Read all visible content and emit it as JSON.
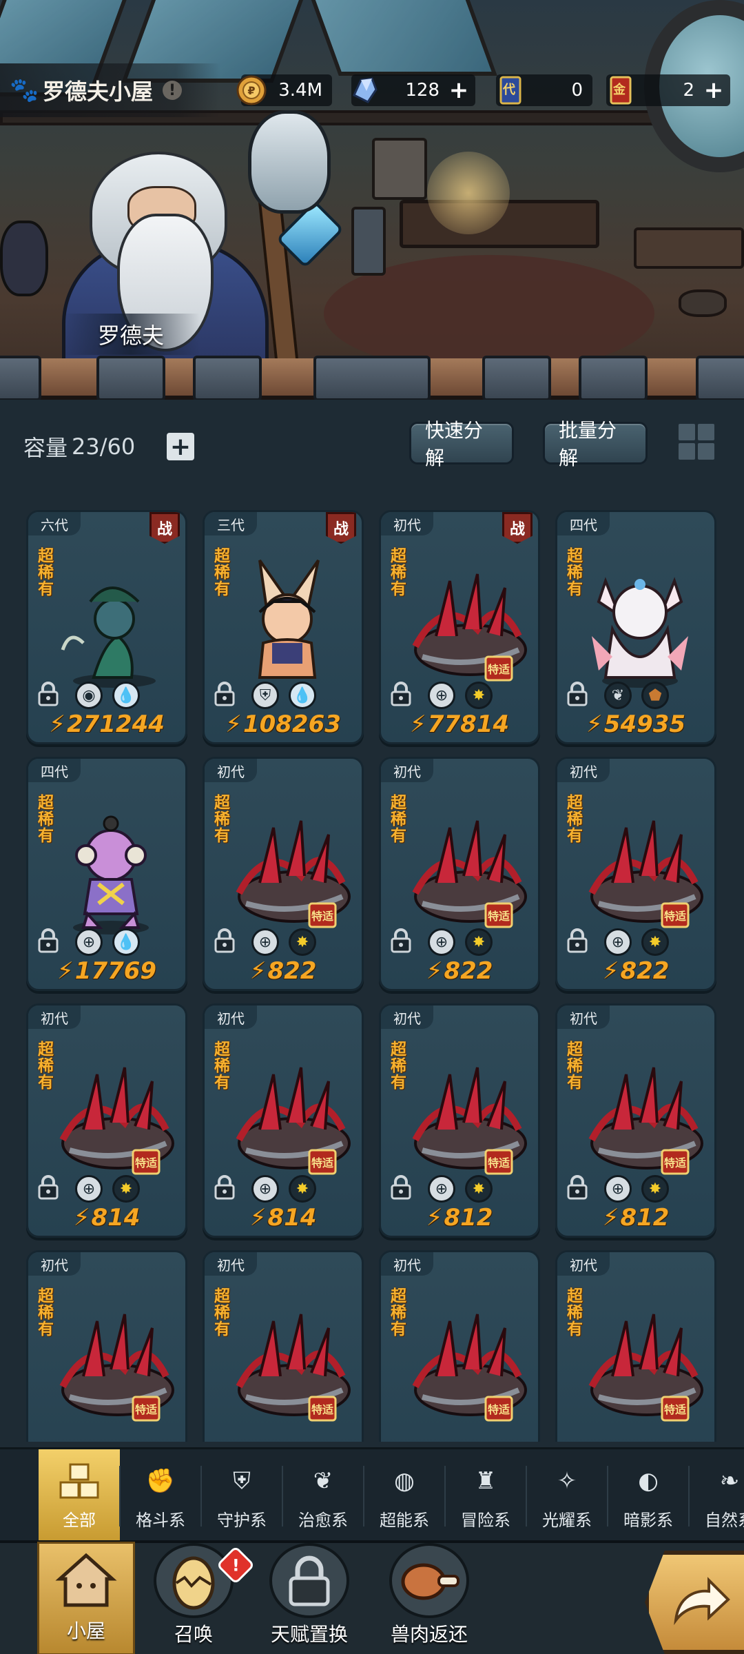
{
  "header": {
    "title": "罗德夫小屋",
    "npc_name": "罗德夫",
    "resources": [
      {
        "icon": "gold-coin-icon",
        "value": "3.4M",
        "has_plus": false
      },
      {
        "icon": "crystal-icon",
        "value": "128",
        "has_plus": true
      },
      {
        "icon": "blue-ticket-icon",
        "value": "0",
        "has_plus": false
      },
      {
        "icon": "gold-ticket-icon",
        "value": "2",
        "has_plus": true
      }
    ],
    "ticket_labels": {
      "blue": "代",
      "gold": "金"
    }
  },
  "storage": {
    "capacity_label": "容量",
    "capacity_value": "23/60",
    "quick_decompose": "快速分解",
    "batch_decompose": "批量分解"
  },
  "cards": [
    {
      "gen": "六代",
      "battle": true,
      "rarity": "超稀有",
      "art": "fish-mage",
      "traits": [
        "eye-icon",
        "water-drop-icon"
      ],
      "power": "271244"
    },
    {
      "gen": "三代",
      "battle": true,
      "rarity": "超稀有",
      "art": "bunny-girl",
      "traits": [
        "shield-icon",
        "water-drop-icon"
      ],
      "power": "108263"
    },
    {
      "gen": "初代",
      "battle": true,
      "rarity": "超稀有",
      "art": "dragon",
      "traits": [
        "crosshair-icon",
        "star-icon"
      ],
      "power": "77814"
    },
    {
      "gen": "四代",
      "battle": false,
      "rarity": "超稀有",
      "art": "white-beast",
      "traits": [
        "leaf-icon",
        "rock-icon"
      ],
      "power": "54935"
    },
    {
      "gen": "四代",
      "battle": false,
      "rarity": "超稀有",
      "art": "frog-dj",
      "traits": [
        "crosshair-icon",
        "water-drop-icon"
      ],
      "power": "17769"
    },
    {
      "gen": "初代",
      "battle": false,
      "rarity": "超稀有",
      "art": "dragon",
      "traits": [
        "crosshair-icon",
        "star-icon"
      ],
      "power": "822"
    },
    {
      "gen": "初代",
      "battle": false,
      "rarity": "超稀有",
      "art": "dragon",
      "traits": [
        "crosshair-icon",
        "star-icon"
      ],
      "power": "822"
    },
    {
      "gen": "初代",
      "battle": false,
      "rarity": "超稀有",
      "art": "dragon",
      "traits": [
        "crosshair-icon",
        "star-icon"
      ],
      "power": "822"
    },
    {
      "gen": "初代",
      "battle": false,
      "rarity": "超稀有",
      "art": "dragon",
      "traits": [
        "crosshair-icon",
        "star-icon"
      ],
      "power": "814"
    },
    {
      "gen": "初代",
      "battle": false,
      "rarity": "超稀有",
      "art": "dragon",
      "traits": [
        "crosshair-icon",
        "star-icon"
      ],
      "power": "814"
    },
    {
      "gen": "初代",
      "battle": false,
      "rarity": "超稀有",
      "art": "dragon",
      "traits": [
        "crosshair-icon",
        "star-icon"
      ],
      "power": "812"
    },
    {
      "gen": "初代",
      "battle": false,
      "rarity": "超稀有",
      "art": "dragon",
      "traits": [
        "crosshair-icon",
        "star-icon"
      ],
      "power": "812"
    },
    {
      "gen": "初代",
      "battle": false,
      "rarity": "超稀有",
      "art": "dragon",
      "traits": [],
      "power": ""
    },
    {
      "gen": "初代",
      "battle": false,
      "rarity": "超稀有",
      "art": "dragon",
      "traits": [],
      "power": ""
    },
    {
      "gen": "初代",
      "battle": false,
      "rarity": "超稀有",
      "art": "dragon",
      "traits": [],
      "power": ""
    },
    {
      "gen": "初代",
      "battle": false,
      "rarity": "超稀有",
      "art": "dragon",
      "traits": [],
      "power": ""
    }
  ],
  "battle_tag": "战",
  "hatch_tag": "特适",
  "filters": [
    {
      "label": "全部",
      "icon": "all-blocks-icon",
      "active": true
    },
    {
      "label": "格斗系",
      "icon": "fist-icon",
      "active": false
    },
    {
      "label": "守护系",
      "icon": "shield-icon",
      "active": false
    },
    {
      "label": "治愈系",
      "icon": "sprout-icon",
      "active": false
    },
    {
      "label": "超能系",
      "icon": "alien-icon",
      "active": false
    },
    {
      "label": "冒险系",
      "icon": "lantern-icon",
      "active": false
    },
    {
      "label": "光耀系",
      "icon": "sparkle-icon",
      "active": false
    },
    {
      "label": "暗影系",
      "icon": "eclipse-icon",
      "active": false
    },
    {
      "label": "自然系",
      "icon": "leaf-icon",
      "active": false
    }
  ],
  "nav": [
    {
      "label": "小屋",
      "icon": "house-icon",
      "active": true
    },
    {
      "label": "召唤",
      "icon": "egg-icon",
      "active": false,
      "badge": "!"
    },
    {
      "label": "天赋置换",
      "icon": "lock-icon",
      "active": false
    },
    {
      "label": "兽肉返还",
      "icon": "meat-icon",
      "active": false
    }
  ]
}
